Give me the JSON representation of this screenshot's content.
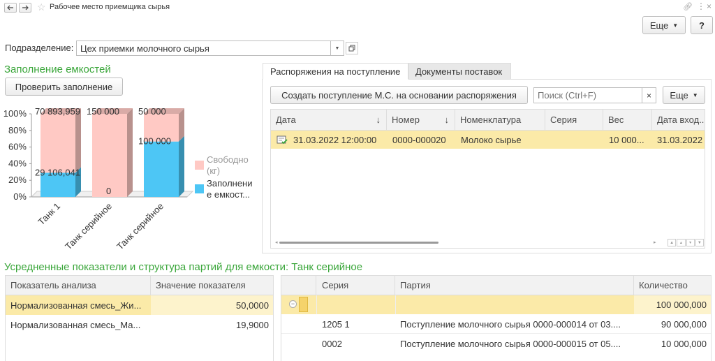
{
  "titlebar": {
    "back_icon": "arrow-left",
    "forward_icon": "arrow-right",
    "star_icon": "star-outline",
    "title": "Рабочее место приемщика сырья",
    "link_icon": "link",
    "menu_icon": "vertical-dots",
    "close_icon": "close-x"
  },
  "toolbar": {
    "more_label": "Еще",
    "help_label": "?"
  },
  "subdivision": {
    "label": "Подразделение:",
    "value": "Цех приемки молочного сырья"
  },
  "fill": {
    "title": "Заполнение емкостей",
    "check_button": "Проверить заполнение"
  },
  "chart_data": {
    "type": "bar",
    "stacked": true,
    "percent": true,
    "categories": [
      "Танк 1",
      "Танк серийное",
      "Танк серийное"
    ],
    "series": [
      {
        "name": "Свободно (кг)",
        "values": [
          70893.959,
          150000,
          50000
        ],
        "color": "#ffc9c4",
        "labels": [
          "70 893,959",
          "150 000",
          "50 000"
        ]
      },
      {
        "name": "Заполнение емкост...",
        "values": [
          29106.041,
          0,
          100000
        ],
        "color": "#4dc6f5",
        "labels": [
          "29 106,041",
          "0",
          "100 000"
        ]
      }
    ],
    "y_ticks": [
      "100%",
      "80%",
      "60%",
      "40%",
      "20%",
      "0%"
    ],
    "legend": [
      {
        "text": "Свободно\n(кг)",
        "color": "#ffc9c4"
      },
      {
        "text": "Заполнени\nе емкост...",
        "color": "#4dc6f5"
      }
    ],
    "legend_position": "right"
  },
  "tabs": [
    {
      "label": "Распоряжения на поступление",
      "active": true
    },
    {
      "label": "Документы поставок",
      "active": false
    }
  ],
  "orders": {
    "create_button": "Создать поступление М.С. на основании распоряжения",
    "search_placeholder": "Поиск (Ctrl+F)",
    "search_clear": "×",
    "more_label": "Еще",
    "columns": [
      "Дата",
      "Номер",
      "Номенклатура",
      "Серия",
      "Вес",
      "Дата вход..."
    ],
    "rows": [
      {
        "date": "31.03.2022 12:00:00",
        "number": "0000-000020",
        "nomenclature": "Молоко сырье",
        "series": "",
        "weight": "10 000...",
        "date_in": "31.03.2022"
      }
    ]
  },
  "avg": {
    "title": "Усредненные показатели и структура партий для емкости: Танк серийное",
    "left_columns": [
      "Показатель анализа",
      "Значение показателя"
    ],
    "left_rows": [
      {
        "name": "Нормализованная смесь_Жи...",
        "value": "50,0000"
      },
      {
        "name": "Нормализованная смесь_Ма...",
        "value": "19,9000"
      }
    ],
    "right_columns": [
      "Серия",
      "Партия",
      "Количество"
    ],
    "right_rows": [
      {
        "series": "",
        "batch": "",
        "qty": "100 000,000",
        "group": true
      },
      {
        "series": "1205 1",
        "batch": "Поступление молочного сырья 0000-000014 от 03....",
        "qty": "90 000,000"
      },
      {
        "series": "0002",
        "batch": "Поступление молочного сырья 0000-000015 от 05....",
        "qty": "10 000,000"
      }
    ]
  }
}
